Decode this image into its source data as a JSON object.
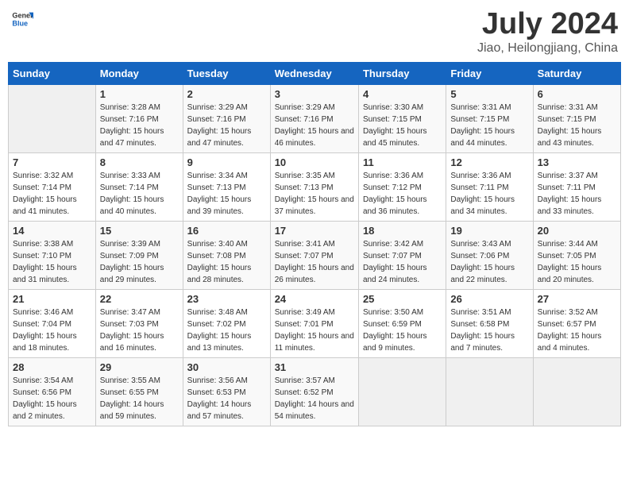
{
  "header": {
    "logo_line1": "General",
    "logo_line2": "Blue",
    "month": "July 2024",
    "location": "Jiao, Heilongjiang, China"
  },
  "weekdays": [
    "Sunday",
    "Monday",
    "Tuesday",
    "Wednesday",
    "Thursday",
    "Friday",
    "Saturday"
  ],
  "weeks": [
    [
      {
        "day": "",
        "sunrise": "",
        "sunset": "",
        "daylight": ""
      },
      {
        "day": "1",
        "sunrise": "Sunrise: 3:28 AM",
        "sunset": "Sunset: 7:16 PM",
        "daylight": "Daylight: 15 hours and 47 minutes."
      },
      {
        "day": "2",
        "sunrise": "Sunrise: 3:29 AM",
        "sunset": "Sunset: 7:16 PM",
        "daylight": "Daylight: 15 hours and 47 minutes."
      },
      {
        "day": "3",
        "sunrise": "Sunrise: 3:29 AM",
        "sunset": "Sunset: 7:16 PM",
        "daylight": "Daylight: 15 hours and 46 minutes."
      },
      {
        "day": "4",
        "sunrise": "Sunrise: 3:30 AM",
        "sunset": "Sunset: 7:15 PM",
        "daylight": "Daylight: 15 hours and 45 minutes."
      },
      {
        "day": "5",
        "sunrise": "Sunrise: 3:31 AM",
        "sunset": "Sunset: 7:15 PM",
        "daylight": "Daylight: 15 hours and 44 minutes."
      },
      {
        "day": "6",
        "sunrise": "Sunrise: 3:31 AM",
        "sunset": "Sunset: 7:15 PM",
        "daylight": "Daylight: 15 hours and 43 minutes."
      }
    ],
    [
      {
        "day": "7",
        "sunrise": "Sunrise: 3:32 AM",
        "sunset": "Sunset: 7:14 PM",
        "daylight": "Daylight: 15 hours and 41 minutes."
      },
      {
        "day": "8",
        "sunrise": "Sunrise: 3:33 AM",
        "sunset": "Sunset: 7:14 PM",
        "daylight": "Daylight: 15 hours and 40 minutes."
      },
      {
        "day": "9",
        "sunrise": "Sunrise: 3:34 AM",
        "sunset": "Sunset: 7:13 PM",
        "daylight": "Daylight: 15 hours and 39 minutes."
      },
      {
        "day": "10",
        "sunrise": "Sunrise: 3:35 AM",
        "sunset": "Sunset: 7:13 PM",
        "daylight": "Daylight: 15 hours and 37 minutes."
      },
      {
        "day": "11",
        "sunrise": "Sunrise: 3:36 AM",
        "sunset": "Sunset: 7:12 PM",
        "daylight": "Daylight: 15 hours and 36 minutes."
      },
      {
        "day": "12",
        "sunrise": "Sunrise: 3:36 AM",
        "sunset": "Sunset: 7:11 PM",
        "daylight": "Daylight: 15 hours and 34 minutes."
      },
      {
        "day": "13",
        "sunrise": "Sunrise: 3:37 AM",
        "sunset": "Sunset: 7:11 PM",
        "daylight": "Daylight: 15 hours and 33 minutes."
      }
    ],
    [
      {
        "day": "14",
        "sunrise": "Sunrise: 3:38 AM",
        "sunset": "Sunset: 7:10 PM",
        "daylight": "Daylight: 15 hours and 31 minutes."
      },
      {
        "day": "15",
        "sunrise": "Sunrise: 3:39 AM",
        "sunset": "Sunset: 7:09 PM",
        "daylight": "Daylight: 15 hours and 29 minutes."
      },
      {
        "day": "16",
        "sunrise": "Sunrise: 3:40 AM",
        "sunset": "Sunset: 7:08 PM",
        "daylight": "Daylight: 15 hours and 28 minutes."
      },
      {
        "day": "17",
        "sunrise": "Sunrise: 3:41 AM",
        "sunset": "Sunset: 7:07 PM",
        "daylight": "Daylight: 15 hours and 26 minutes."
      },
      {
        "day": "18",
        "sunrise": "Sunrise: 3:42 AM",
        "sunset": "Sunset: 7:07 PM",
        "daylight": "Daylight: 15 hours and 24 minutes."
      },
      {
        "day": "19",
        "sunrise": "Sunrise: 3:43 AM",
        "sunset": "Sunset: 7:06 PM",
        "daylight": "Daylight: 15 hours and 22 minutes."
      },
      {
        "day": "20",
        "sunrise": "Sunrise: 3:44 AM",
        "sunset": "Sunset: 7:05 PM",
        "daylight": "Daylight: 15 hours and 20 minutes."
      }
    ],
    [
      {
        "day": "21",
        "sunrise": "Sunrise: 3:46 AM",
        "sunset": "Sunset: 7:04 PM",
        "daylight": "Daylight: 15 hours and 18 minutes."
      },
      {
        "day": "22",
        "sunrise": "Sunrise: 3:47 AM",
        "sunset": "Sunset: 7:03 PM",
        "daylight": "Daylight: 15 hours and 16 minutes."
      },
      {
        "day": "23",
        "sunrise": "Sunrise: 3:48 AM",
        "sunset": "Sunset: 7:02 PM",
        "daylight": "Daylight: 15 hours and 13 minutes."
      },
      {
        "day": "24",
        "sunrise": "Sunrise: 3:49 AM",
        "sunset": "Sunset: 7:01 PM",
        "daylight": "Daylight: 15 hours and 11 minutes."
      },
      {
        "day": "25",
        "sunrise": "Sunrise: 3:50 AM",
        "sunset": "Sunset: 6:59 PM",
        "daylight": "Daylight: 15 hours and 9 minutes."
      },
      {
        "day": "26",
        "sunrise": "Sunrise: 3:51 AM",
        "sunset": "Sunset: 6:58 PM",
        "daylight": "Daylight: 15 hours and 7 minutes."
      },
      {
        "day": "27",
        "sunrise": "Sunrise: 3:52 AM",
        "sunset": "Sunset: 6:57 PM",
        "daylight": "Daylight: 15 hours and 4 minutes."
      }
    ],
    [
      {
        "day": "28",
        "sunrise": "Sunrise: 3:54 AM",
        "sunset": "Sunset: 6:56 PM",
        "daylight": "Daylight: 15 hours and 2 minutes."
      },
      {
        "day": "29",
        "sunrise": "Sunrise: 3:55 AM",
        "sunset": "Sunset: 6:55 PM",
        "daylight": "Daylight: 14 hours and 59 minutes."
      },
      {
        "day": "30",
        "sunrise": "Sunrise: 3:56 AM",
        "sunset": "Sunset: 6:53 PM",
        "daylight": "Daylight: 14 hours and 57 minutes."
      },
      {
        "day": "31",
        "sunrise": "Sunrise: 3:57 AM",
        "sunset": "Sunset: 6:52 PM",
        "daylight": "Daylight: 14 hours and 54 minutes."
      },
      {
        "day": "",
        "sunrise": "",
        "sunset": "",
        "daylight": ""
      },
      {
        "day": "",
        "sunrise": "",
        "sunset": "",
        "daylight": ""
      },
      {
        "day": "",
        "sunrise": "",
        "sunset": "",
        "daylight": ""
      }
    ]
  ]
}
